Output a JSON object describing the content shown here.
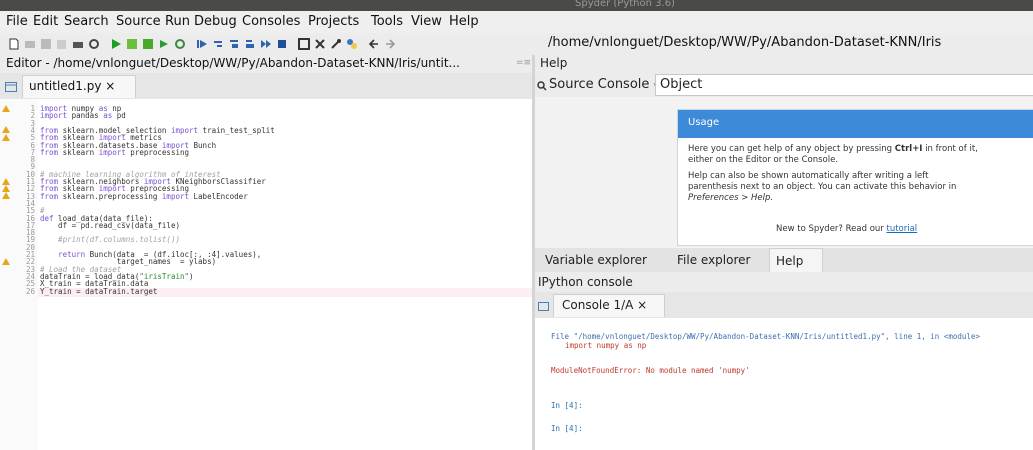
{
  "window": {
    "title": "Spyder (Python 3.6)"
  },
  "menu": [
    "File",
    "Edit",
    "Search",
    "Source",
    "Run",
    "Debug",
    "Consoles",
    "Projects",
    "Tools",
    "View",
    "Help"
  ],
  "toolbar": {
    "path": "/home/vnlonguet/Desktop/WW/Py/Abandon-Dataset-KNN/Iris"
  },
  "editor": {
    "pane_title": "Editor - /home/vnlonguet/Desktop/WW/Py/Abandon-Dataset-KNN/Iris/untit...",
    "tab_label": "untitled1.py ×",
    "lines": [
      {
        "num": "1",
        "warn": true,
        "text": "import numpy as np"
      },
      {
        "num": "2",
        "warn": false,
        "text": "import pandas as pd"
      },
      {
        "num": "3",
        "warn": false,
        "text": ""
      },
      {
        "num": "4",
        "warn": true,
        "text": "from sklearn.model_selection import train_test_split"
      },
      {
        "num": "5",
        "warn": true,
        "text": "from sklearn import metrics"
      },
      {
        "num": "6",
        "warn": false,
        "text": "from sklearn.datasets.base import Bunch"
      },
      {
        "num": "7",
        "warn": false,
        "text": "from sklearn import preprocessing"
      },
      {
        "num": "8",
        "warn": false,
        "text": ""
      },
      {
        "num": "9",
        "warn": false,
        "text": ""
      },
      {
        "num": "10",
        "warn": false,
        "text": "# machine learning algorithm of interest"
      },
      {
        "num": "11",
        "warn": true,
        "text": "from sklearn.neighbors import KNeighborsClassifier"
      },
      {
        "num": "12",
        "warn": true,
        "text": "from sklearn import preprocessing"
      },
      {
        "num": "13",
        "warn": true,
        "text": "from sklearn.preprocessing import LabelEncoder"
      },
      {
        "num": "14",
        "warn": false,
        "text": ""
      },
      {
        "num": "15",
        "warn": false,
        "text": "#"
      },
      {
        "num": "16",
        "warn": false,
        "text": "def load_data(data_file):"
      },
      {
        "num": "17",
        "warn": false,
        "text": "    df = pd.read_csv(data_file)"
      },
      {
        "num": "18",
        "warn": false,
        "text": ""
      },
      {
        "num": "19",
        "warn": false,
        "text": "    #print(df.columns.tolist())"
      },
      {
        "num": "20",
        "warn": false,
        "text": ""
      },
      {
        "num": "21",
        "warn": false,
        "text": "    return Bunch(data  = (df.iloc[:, :4].values),"
      },
      {
        "num": "22",
        "warn": true,
        "text": "                 target_names  = ylabs)"
      },
      {
        "num": "23",
        "warn": false,
        "text": "# Load the dataset"
      },
      {
        "num": "24",
        "warn": false,
        "text": "dataTrain = load_data(\"irisTrain\")"
      },
      {
        "num": "25",
        "warn": false,
        "text": "X_train = dataTrain.data"
      },
      {
        "num": "26",
        "warn": false,
        "text": "Y_train = dataTrain.target"
      }
    ]
  },
  "help": {
    "pane_title": "Help",
    "source_label": "Source Console",
    "object_label": "Object",
    "usage_title": "Usage",
    "para1_a": "Here you can get help of any object by pressing",
    "para1_key": "Ctrl+I",
    "para1_b": "in front of it,",
    "para1_c": "either on the Editor or the Console.",
    "para2_a": "Help can also be shown automatically after writing a left",
    "para2_b": "parenthesis next to an object. You can activate this behavior in",
    "para2_c": "Preferences > Help.",
    "new_to": "New to Spyder? Read our",
    "tutorial": "tutorial"
  },
  "panel_tabs": [
    "Variable explorer",
    "File explorer",
    "Help"
  ],
  "console": {
    "pane_title": "IPython console",
    "tab_label": "Console 1/A ×",
    "file_line": "File \"/home/vnlonguet/Desktop/WW/Py/Abandon-Dataset-KNN/Iris/untitled1.py\", line 1, in <module>",
    "code_line": "import numpy as np",
    "error": "ModuleNotFoundError: No module named 'numpy'",
    "prompt1": "In [4]:",
    "prompt2": "In [4]:"
  }
}
